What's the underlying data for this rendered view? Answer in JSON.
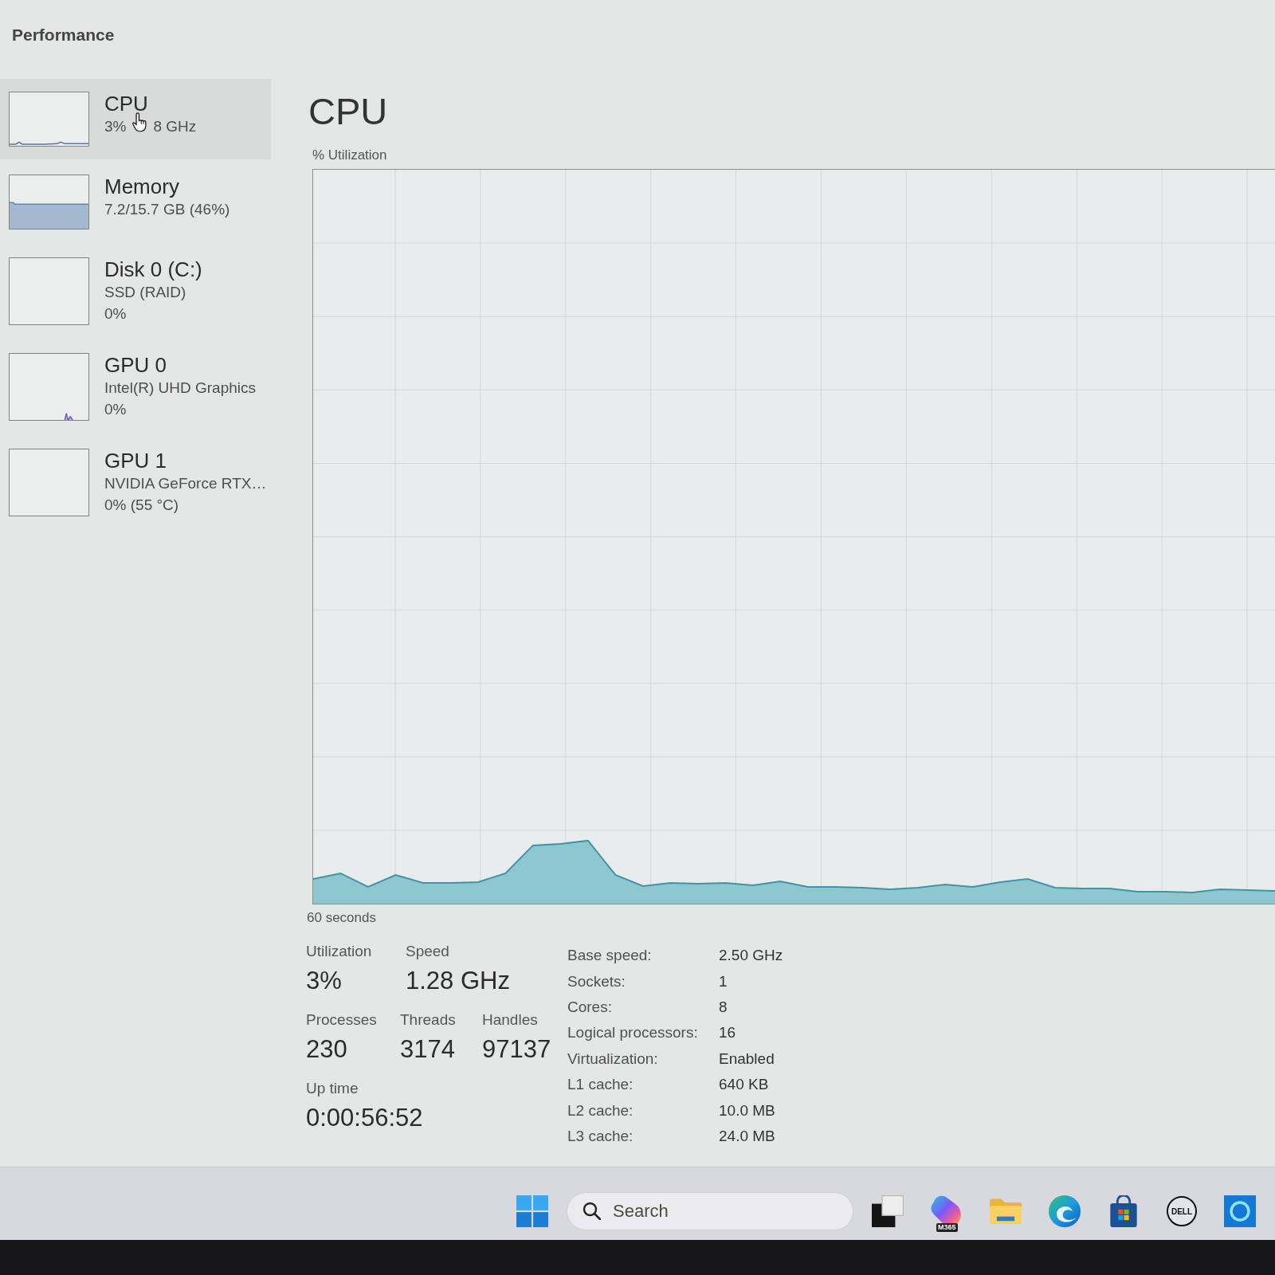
{
  "header": {
    "title": "Performance"
  },
  "sidebar": {
    "items": [
      {
        "title": "CPU",
        "kind": "line",
        "selected": true,
        "hovered": true,
        "lines": [
          [
            "3%",
            "8 GHz"
          ]
        ]
      },
      {
        "title": "Memory",
        "kind": "area",
        "selected": false,
        "hovered": false,
        "lines": [
          [
            "7.2/15.7 GB (46%)"
          ]
        ]
      },
      {
        "title": "Disk 0 (C:)",
        "kind": "empty",
        "selected": false,
        "hovered": false,
        "lines": [
          [
            "SSD (RAID)"
          ],
          [
            "0%"
          ]
        ]
      },
      {
        "title": "GPU 0",
        "kind": "blip",
        "selected": false,
        "hovered": false,
        "lines": [
          [
            "Intel(R) UHD Graphics"
          ],
          [
            "0%"
          ]
        ]
      },
      {
        "title": "GPU 1",
        "kind": "empty",
        "selected": false,
        "hovered": false,
        "lines": [
          [
            "NVIDIA GeForce RTX…"
          ],
          [
            "0% (55 °C)"
          ]
        ]
      }
    ]
  },
  "main": {
    "title": "CPU",
    "chart": {
      "y_label": "% Utilization",
      "x_label": "60 seconds"
    },
    "stats": {
      "rows": [
        [
          {
            "label": "Utilization",
            "value": "3%"
          },
          {
            "label": "Speed",
            "value": "1.28 GHz"
          }
        ],
        [
          {
            "label": "Processes",
            "value": "230"
          },
          {
            "label": "Threads",
            "value": "3174"
          },
          {
            "label": "Handles",
            "value": "97137"
          }
        ],
        [
          {
            "label": "Up time",
            "value": "0:00:56:52"
          }
        ]
      ]
    },
    "details": [
      {
        "label": "Base speed:",
        "value": "2.50 GHz"
      },
      {
        "label": "Sockets:",
        "value": "1"
      },
      {
        "label": "Cores:",
        "value": "8"
      },
      {
        "label": "Logical processors:",
        "value": "16"
      },
      {
        "label": "Virtualization:",
        "value": "Enabled"
      },
      {
        "label": "L1 cache:",
        "value": "640 KB"
      },
      {
        "label": "L2 cache:",
        "value": "10.0 MB"
      },
      {
        "label": "L3 cache:",
        "value": "24.0 MB"
      }
    ]
  },
  "taskbar": {
    "search": {
      "placeholder": "Search"
    },
    "app_badge": "M365",
    "logo_text": "DELL"
  }
}
